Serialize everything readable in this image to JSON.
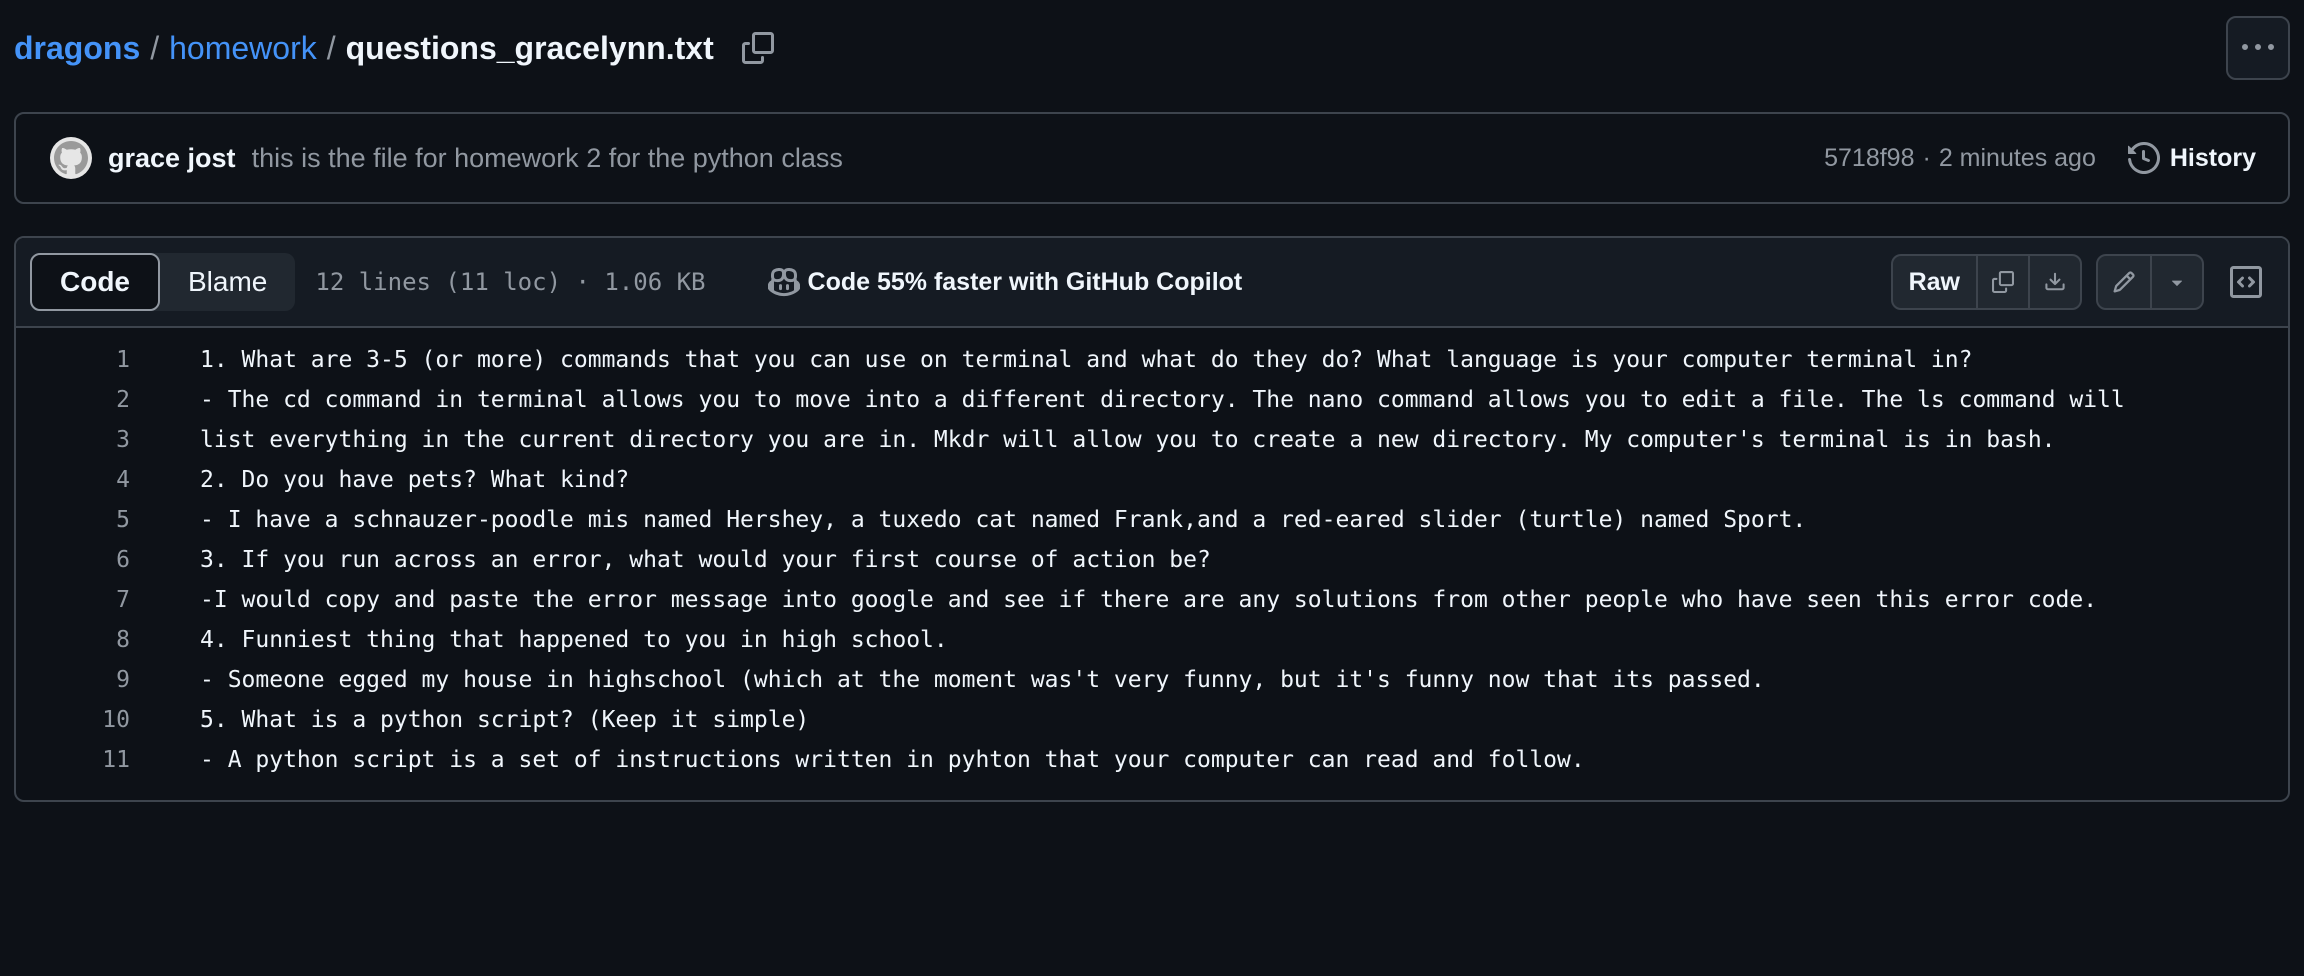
{
  "breadcrumb": {
    "repo": "dragons",
    "sep": "/",
    "folder": "homework",
    "file": "questions_gracelynn.txt"
  },
  "commit": {
    "author": "grace jost",
    "message": "this is the file for homework 2 for the python class",
    "sha": "5718f98",
    "dot": "·",
    "time": "2 minutes ago",
    "history_label": "History"
  },
  "file_header": {
    "code_tab": "Code",
    "blame_tab": "Blame",
    "meta": "12 lines (11 loc) · 1.06 KB",
    "copilot": "Code 55% faster with GitHub Copilot",
    "raw_label": "Raw"
  },
  "lines": [
    {
      "num": "1",
      "text": "1. What are 3-5 (or more) commands that you can use on terminal and what do they do? What language is your computer terminal in?"
    },
    {
      "num": "2",
      "text": "- The cd command in terminal allows you to move into a different directory. The nano command allows you to edit a file. The ls command will"
    },
    {
      "num": "3",
      "text": "list everything in the current directory you are in. Mkdr will allow you to create a new directory. My computer's terminal is in bash."
    },
    {
      "num": "4",
      "text": "2. Do you have pets? What kind?"
    },
    {
      "num": "5",
      "text": "- I have a schnauzer-poodle mis named Hershey, a tuxedo cat named Frank,and a red-eared slider (turtle) named Sport."
    },
    {
      "num": "6",
      "text": "3. If you run across an error, what would your first course of action be?"
    },
    {
      "num": "7",
      "text": "-I would copy and paste the error message into google and see if there are any solutions from other people who have seen this error code."
    },
    {
      "num": "8",
      "text": "4. Funniest thing that happened to you in high school."
    },
    {
      "num": "9",
      "text": "- Someone egged my house in highschool (which at the moment was't very funny, but it's funny now that its passed."
    },
    {
      "num": "10",
      "text": "5. What is a python script? (Keep it simple)"
    },
    {
      "num": "11",
      "text": "- A python script is a set of instructions written in pyhton that your computer can read and follow."
    }
  ],
  "icons": {
    "copy": "copy-icon",
    "more": "kebab-horizontal-icon",
    "history": "history-icon",
    "copilot": "copilot-icon",
    "download": "download-icon",
    "pencil": "pencil-icon",
    "triangle": "triangle-down-icon",
    "symbols": "code-square-icon",
    "avatar": "github-octocat-avatar"
  }
}
